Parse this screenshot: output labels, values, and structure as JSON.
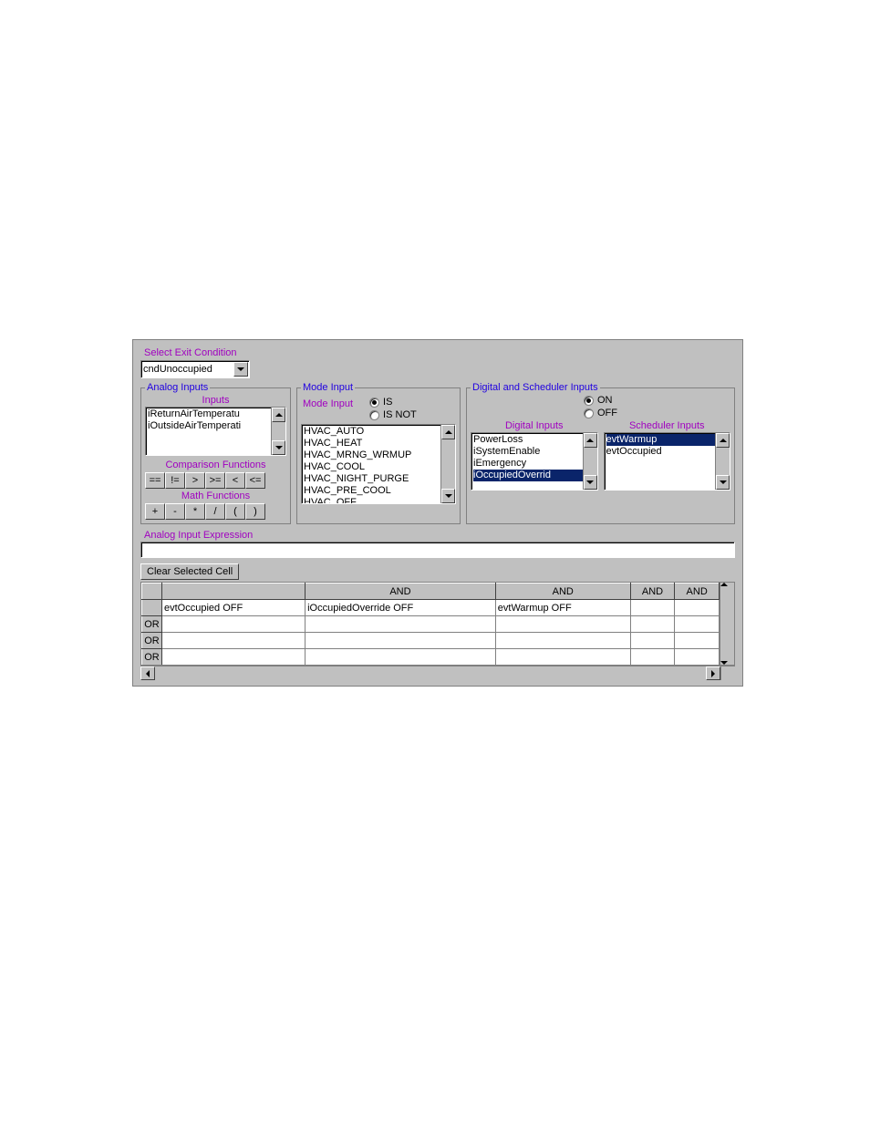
{
  "selectExit": {
    "label": "Select Exit Condition",
    "value": "cndUnoccupied"
  },
  "analogInputs": {
    "legend": "Analog Inputs",
    "inputsLabel": "Inputs",
    "items": [
      "iReturnAirTemperatu",
      "iOutsideAirTemperati"
    ],
    "compLabel": "Comparison Functions",
    "compBtns": [
      "==",
      "!=",
      ">",
      ">=",
      "<",
      "<="
    ],
    "mathLabel": "Math Functions",
    "mathBtns": [
      "+",
      "-",
      "*",
      "/",
      "(",
      ")"
    ]
  },
  "modeInput": {
    "legend": "Mode Input",
    "label": "Mode Input",
    "radioIs": "IS",
    "radioIsNot": "IS NOT",
    "items": [
      "HVAC_AUTO",
      "HVAC_HEAT",
      "HVAC_MRNG_WRMUP",
      "HVAC_COOL",
      "HVAC_NIGHT_PURGE",
      "HVAC_PRE_COOL",
      "HVAC_OFF"
    ]
  },
  "digSched": {
    "legend": "Digital and Scheduler Inputs",
    "radioOn": "ON",
    "radioOff": "OFF",
    "digitalLabel": "Digital Inputs",
    "digitalItems": [
      "PowerLoss",
      "iSystemEnable",
      "iEmergency",
      "iOccupiedOverrid"
    ],
    "digitalSelectedIndex": 3,
    "schedLabel": "Scheduler Inputs",
    "schedItems": [
      "evtWarmup",
      "evtOccupied"
    ],
    "schedSelectedIndex": 0
  },
  "expression": {
    "label": "Analog Input Expression",
    "value": ""
  },
  "clearBtn": "Clear Selected Cell",
  "grid": {
    "headers": [
      "",
      "",
      "AND",
      "AND",
      "AND",
      "AND"
    ],
    "rows": [
      {
        "head": "",
        "cells": [
          "evtOccupied OFF",
          "iOccupiedOverride OFF",
          "evtWarmup OFF",
          "",
          ""
        ]
      },
      {
        "head": "OR",
        "cells": [
          "",
          "",
          "",
          "",
          ""
        ]
      },
      {
        "head": "OR",
        "cells": [
          "",
          "",
          "",
          "",
          ""
        ]
      },
      {
        "head": "OR",
        "cells": [
          "",
          "",
          "",
          "",
          ""
        ]
      }
    ]
  }
}
